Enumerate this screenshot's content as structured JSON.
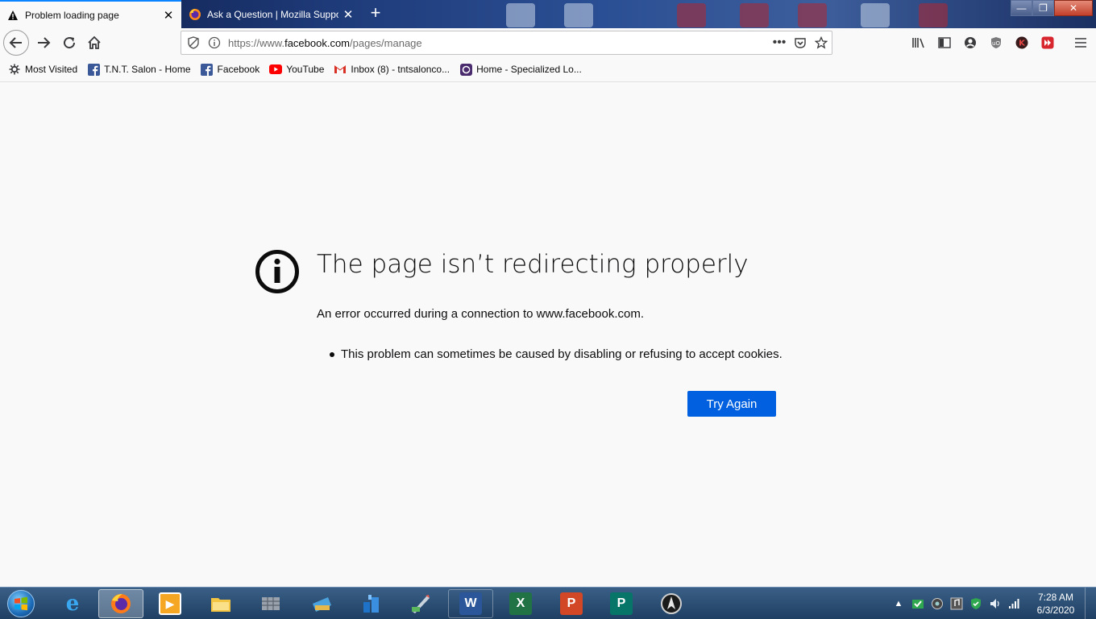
{
  "window": {
    "minimize_label": "—",
    "maximize_label": "❐",
    "close_label": "✕"
  },
  "tabs": [
    {
      "label": "Problem loading page",
      "icon": "warning-icon",
      "active": true
    },
    {
      "label": "Ask a Question | Mozilla Suppo",
      "icon": "firefox-icon",
      "active": false
    }
  ],
  "new_tab_label": "+",
  "navbar": {
    "url_prefix": "https://www.",
    "url_host": "facebook.com",
    "url_path": "/pages/manage",
    "page_actions_label": "•••"
  },
  "bookmarks": [
    {
      "label": "Most Visited",
      "icon": "gear-icon"
    },
    {
      "label": "T.N.T. Salon - Home",
      "icon": "facebook-icon"
    },
    {
      "label": "Facebook",
      "icon": "facebook-icon"
    },
    {
      "label": "YouTube",
      "icon": "youtube-icon"
    },
    {
      "label": "Inbox (8) - tntsalonco...",
      "icon": "gmail-icon"
    },
    {
      "label": "Home - Specialized Lo...",
      "icon": "site-icon"
    }
  ],
  "error": {
    "title": "The page isn’t redirecting properly",
    "description": "An error occurred during a connection to www.facebook.com.",
    "bullets": [
      "This problem can sometimes be caused by disabling or refusing to accept cookies."
    ],
    "button_label": "Try Again"
  },
  "taskbar": {
    "time": "7:28 AM",
    "date": "6/3/2020",
    "apps": [
      {
        "name": "internet-explorer",
        "label": "e"
      },
      {
        "name": "firefox",
        "label": ""
      },
      {
        "name": "media-player",
        "label": "▶"
      },
      {
        "name": "file-explorer",
        "label": ""
      },
      {
        "name": "app-grid",
        "label": ""
      },
      {
        "name": "scanner",
        "label": ""
      },
      {
        "name": "network",
        "label": ""
      },
      {
        "name": "paint",
        "label": ""
      },
      {
        "name": "word",
        "label": "W"
      },
      {
        "name": "excel",
        "label": "X"
      },
      {
        "name": "powerpoint",
        "label": "P"
      },
      {
        "name": "publisher",
        "label": "P"
      },
      {
        "name": "app-dark",
        "label": ""
      }
    ]
  },
  "colors": {
    "accent": "#0060df",
    "tab_highlight": "#0a84ff",
    "page_bg": "#f9f9fa"
  }
}
